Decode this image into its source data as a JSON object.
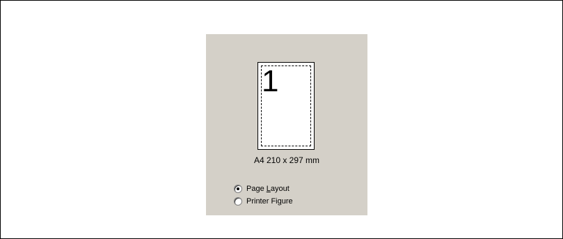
{
  "preview": {
    "page_number": "1",
    "paper_size": "A4 210 x 297 mm"
  },
  "view_mode": {
    "options": [
      {
        "pre": "Page ",
        "accel": "L",
        "post": "ayout",
        "selected": true
      },
      {
        "pre": "Printer Fi",
        "accel": "g",
        "post": "ure",
        "selected": false
      }
    ]
  },
  "colors": {
    "panel_background": "#d4d0c8",
    "page_background": "#ffffff",
    "border": "#000000"
  }
}
